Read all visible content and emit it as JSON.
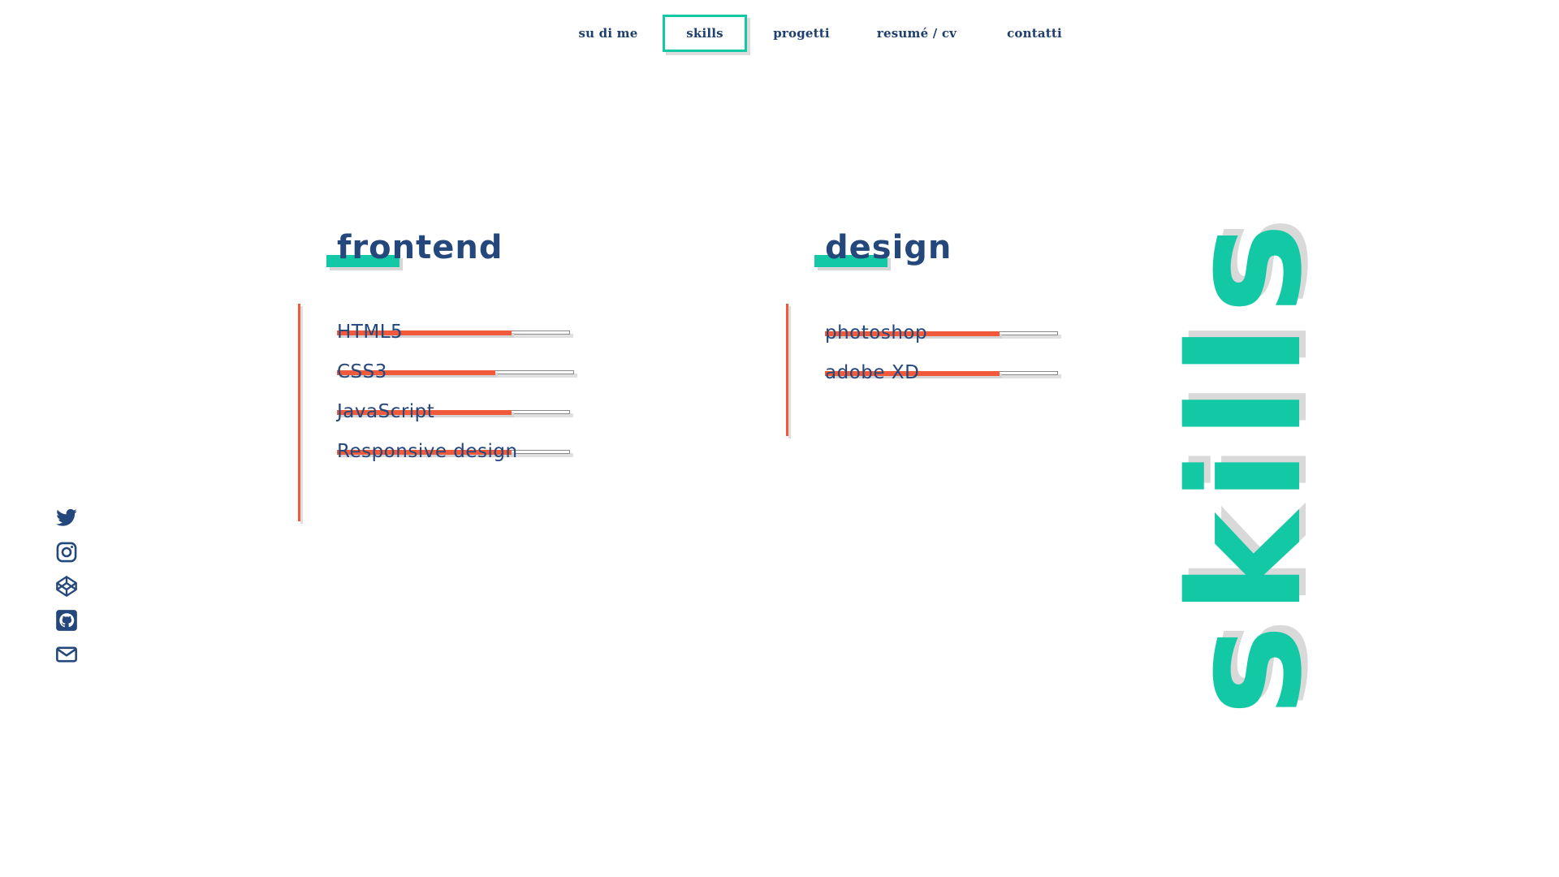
{
  "nav": {
    "items": [
      {
        "label": "su di me"
      },
      {
        "label": "skills",
        "active": true
      },
      {
        "label": "progetti"
      },
      {
        "label": "resumé / cv"
      },
      {
        "label": "contatti"
      }
    ]
  },
  "frontend": {
    "title": "frontend",
    "skills": [
      {
        "name": "HTML5",
        "level": 0.75
      },
      {
        "name": "CSS3",
        "level": 0.68
      },
      {
        "name": "JavaScript",
        "level": 0.75
      },
      {
        "name": "Responsive design",
        "level": 0.75
      }
    ]
  },
  "design": {
    "title": "design",
    "skills": [
      {
        "name": "photoshop",
        "level": 0.75
      },
      {
        "name": "adobe XD",
        "level": 0.75
      }
    ]
  },
  "social": {
    "icons": [
      "twitter-icon",
      "instagram-icon",
      "codepen-icon",
      "github-icon",
      "mail-icon"
    ]
  },
  "section_label": "skills",
  "colors": {
    "accent": "#13c8a4",
    "bar": "#f05a3b",
    "text": "#24477c"
  }
}
